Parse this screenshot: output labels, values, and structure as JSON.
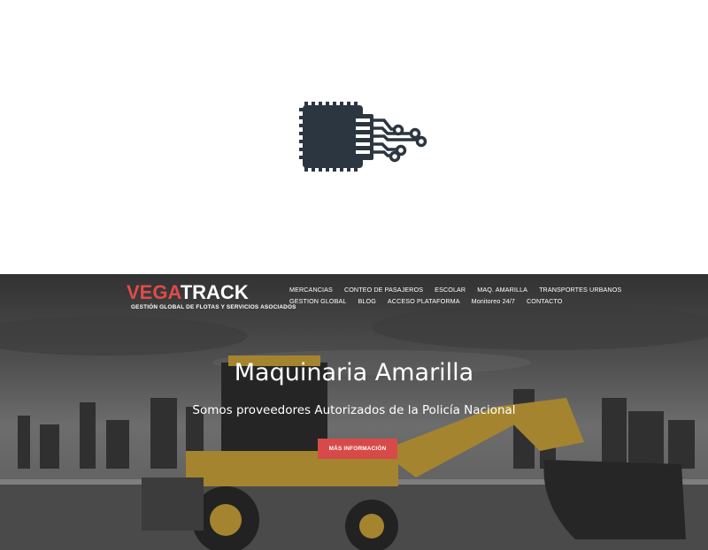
{
  "header": {
    "logo_part1": "VEGA",
    "logo_part2": "TRACK",
    "logo_tagline": "GESTIÓN GLOBAL DE FLOTAS Y SERVICIOS ASOCIADOS"
  },
  "nav": {
    "row1": [
      "MERCANCIAS",
      "CONTEO DE PASAJEROS",
      "ESCOLAR",
      "MAQ. AMARILLA",
      "TRANSPORTES URBANOS"
    ],
    "row2": [
      "GESTION GLOBAL",
      "BLOG",
      "ACCESO PLATAFORMA",
      "Monitoreo 24/7",
      "CONTACTO"
    ]
  },
  "hero": {
    "title": "Maquinaria Amarilla",
    "subtitle": "Somos proveedores Autorizados de la Policía Nacional",
    "cta_label": "MÁS INFORMACIÓN"
  },
  "icons": {
    "loading": "chip-circuit-icon"
  },
  "colors": {
    "accent": "#d84a4a",
    "brand_red": "#e04b4b",
    "icon": "#2b3640"
  }
}
